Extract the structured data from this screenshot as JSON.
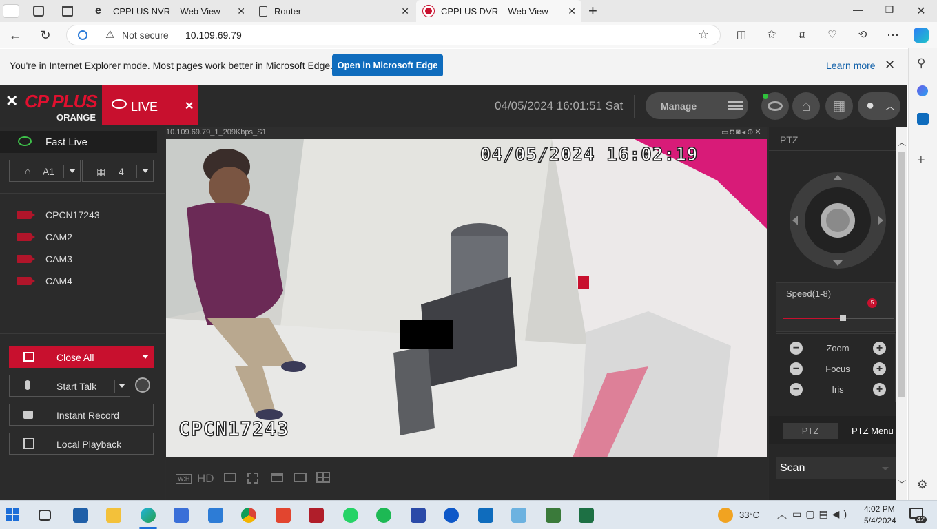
{
  "browser": {
    "tabs": [
      {
        "title": "CPPLUS NVR – Web View"
      },
      {
        "title": "Router"
      },
      {
        "title": "CPPLUS DVR – Web View"
      }
    ],
    "not_secure": "Not secure",
    "url": "10.109.69.79"
  },
  "ie_mode": {
    "message": "You're in Internet Explorer mode. Most pages work better in Microsoft Edge.",
    "open_button": "Open in Microsoft Edge",
    "learn_more": "Learn more"
  },
  "app": {
    "logo_top": "CP PLUS",
    "logo_bottom": "ORANGE",
    "live_tab": "LIVE",
    "datetime": "04/05/2024 16:01:51 Sat",
    "manage": "Manage"
  },
  "left": {
    "fast_live": "Fast Live",
    "group": "A1",
    "layout": "4",
    "cameras": [
      "CPCN17243",
      "CAM2",
      "CAM3",
      "CAM4"
    ],
    "close_all": "Close All",
    "start_talk": "Start Talk",
    "instant_record": "Instant Record",
    "local_playback": "Local Playback"
  },
  "video": {
    "stream_label": "10.109.69.79_1_209Kbps_S1",
    "osd_timestamp": "04/05/2024 16:02:19",
    "osd_name": "CPCN17243"
  },
  "toolbar": {
    "wh": "W:H",
    "hd": "HD"
  },
  "ptz": {
    "title": "PTZ",
    "speed_label": "Speed(1-8)",
    "speed_value": "5",
    "zoom": "Zoom",
    "focus": "Focus",
    "iris": "Iris",
    "tab_ptz": "PTZ",
    "tab_menu": "PTZ Menu",
    "scan": "Scan"
  },
  "taskbar": {
    "temperature": "33°C",
    "time": "4:02 PM",
    "date": "5/4/2024",
    "notifications": "42"
  }
}
